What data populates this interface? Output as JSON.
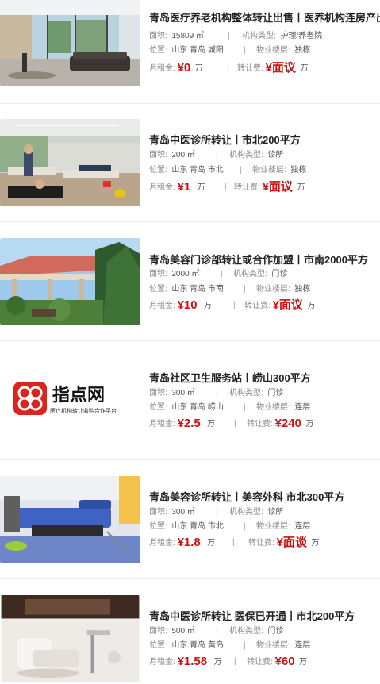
{
  "labels": {
    "area": "面积:",
    "type": "机构类型:",
    "location": "位置:",
    "floor": "物业楼层:",
    "rent": "月租金:",
    "transfer": "转让费:",
    "unit_wan": "万",
    "currency": "¥"
  },
  "listings": [
    {
      "title": "青岛医疗养老机构整体转让出售丨医养机构连房产出",
      "area": "15809 ㎡",
      "type": "护理/养老院",
      "location": "山东 青岛 城阳",
      "floor": "独栋",
      "rent": "0",
      "transfer": "面议",
      "image": "nursing-lounge-photo"
    },
    {
      "title": "青岛中医诊所转让丨市北200平方",
      "area": "200 ㎡",
      "type": "诊所",
      "location": "山东 青岛 市北",
      "floor": "独栋",
      "rent": "1",
      "transfer": "面议",
      "image": "clinic-treatment-room-photo"
    },
    {
      "title": "青岛美容门诊部转让或合作加盟丨市南2000平方",
      "area": "2000 ㎡",
      "type": "门诊",
      "location": "山东 青岛 市南",
      "floor": "独栋",
      "rent": "10",
      "transfer": "面议",
      "image": "garden-pavilion-photo"
    },
    {
      "title": "青岛社区卫生服务站丨崂山300平方",
      "area": "300 ㎡",
      "type": "门诊",
      "location": "山东 青岛 崂山",
      "floor": "连层",
      "rent": "2.5",
      "transfer": "240",
      "image": "zhidianwang-logo",
      "logo_title": "指点网",
      "logo_subtitle": "医疗机构转让收购合作平台"
    },
    {
      "title": "青岛美容诊所转让丨美容外科 市北300平方",
      "area": "300 ㎡",
      "type": "诊所",
      "location": "山东 青岛 市北",
      "floor": "连层",
      "rent": "1.8",
      "transfer": "面谈",
      "image": "surgery-bed-photo"
    },
    {
      "title": "青岛中医诊所转让 医保已开通丨市北200平方",
      "area": "500 ㎡",
      "type": "门诊",
      "location": "山东 青岛 黄岛",
      "floor": "连层",
      "rent": "1.58",
      "transfer": "60",
      "image": "dental-chair-photo"
    }
  ]
}
